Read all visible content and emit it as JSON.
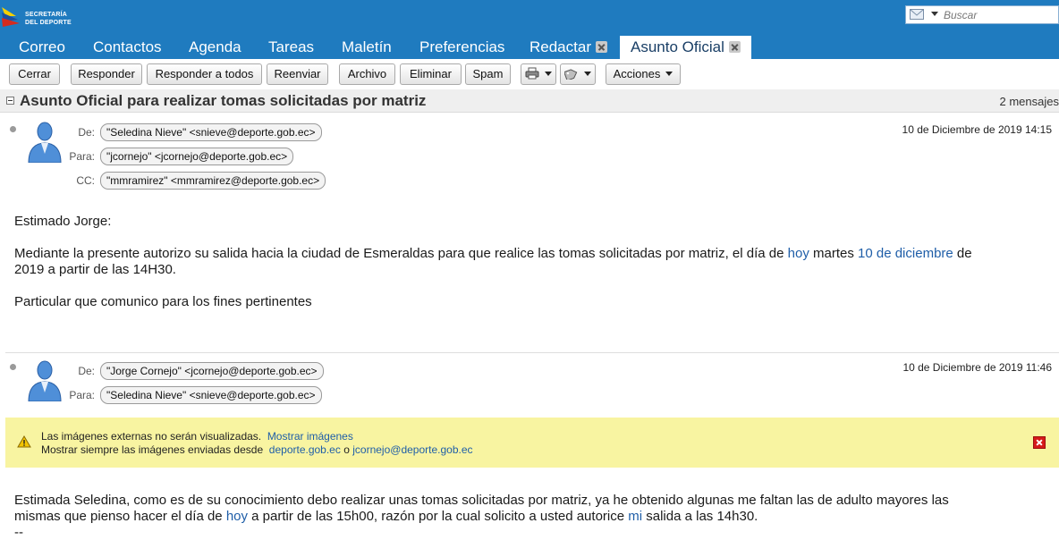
{
  "header": {
    "logo_line1": "SECRETARÍA",
    "logo_line2": "DEL DEPORTE",
    "search_placeholder": "Buscar"
  },
  "tabs": [
    {
      "label": "Correo"
    },
    {
      "label": "Contactos"
    },
    {
      "label": "Agenda"
    },
    {
      "label": "Tareas"
    },
    {
      "label": "Maletín"
    },
    {
      "label": "Preferencias"
    },
    {
      "label": "Redactar"
    },
    {
      "label": "Asunto Oficial"
    }
  ],
  "toolbar": {
    "close": "Cerrar",
    "reply": "Responder",
    "reply_all": "Responder a todos",
    "forward": "Reenviar",
    "archive": "Archivo",
    "delete": "Eliminar",
    "spam": "Spam",
    "actions": "Acciones"
  },
  "conversation": {
    "subject": "Asunto Oficial para realizar tomas solicitadas por matriz",
    "count": "2 mensajes"
  },
  "labels": {
    "from": "De:",
    "to": "Para:",
    "cc": "CC:"
  },
  "message1": {
    "from": "\"Seledina Nieve\" <snieve@deporte.gob.ec>",
    "to": "\"jcornejo\" <jcornejo@deporte.gob.ec>",
    "cc": "\"mmramirez\" <mmramirez@deporte.gob.ec>",
    "date": "10 de Diciembre de 2019 14:15",
    "greeting": "Estimado Jorge:",
    "p1_a": "Mediante la presente autorizo su salida hacia la ciudad de Esmeraldas para que realice las tomas solicitadas por matriz,  el día de ",
    "p1_link1": "hoy",
    "p1_b": " martes ",
    "p1_link2": "10 de diciembre",
    "p1_c": " de",
    "p1_line2": "2019 a partir de las 14H30.",
    "p2": "Particular que comunico para los fines pertinentes"
  },
  "message2": {
    "from": "\"Jorge Cornejo\" <jcornejo@deporte.gob.ec>",
    "to": "\"Seledina Nieve\" <snieve@deporte.gob.ec>",
    "date": "10 de Diciembre de 2019 11:46",
    "line1": "Estimada Seledina, como es de su conocimiento debo realizar unas tomas solicitadas por matriz, ya he obtenido algunas me faltan las de adulto mayores las",
    "line2_a": "mismas que pienso hacer el día de ",
    "line2_link1": "hoy",
    "line2_b": " a partir de las 15h00, razón por la cual solicito a usted autorice ",
    "line2_link2": "mi",
    "line2_c": " salida a las 14h30.",
    "signature_dash": "--"
  },
  "warning": {
    "line1": "Las imágenes externas no serán visualizadas.",
    "show_images": "Mostrar imágenes",
    "line2": "Mostrar siempre las imágenes enviadas desde",
    "domain": "deporte.gob.ec",
    "or": "o",
    "sender": "jcornejo@deporte.gob.ec"
  },
  "colors": {
    "header_blue": "#1f7bbf",
    "link_blue": "#1f5ea8",
    "warning_yellow": "#f8f4a1"
  }
}
